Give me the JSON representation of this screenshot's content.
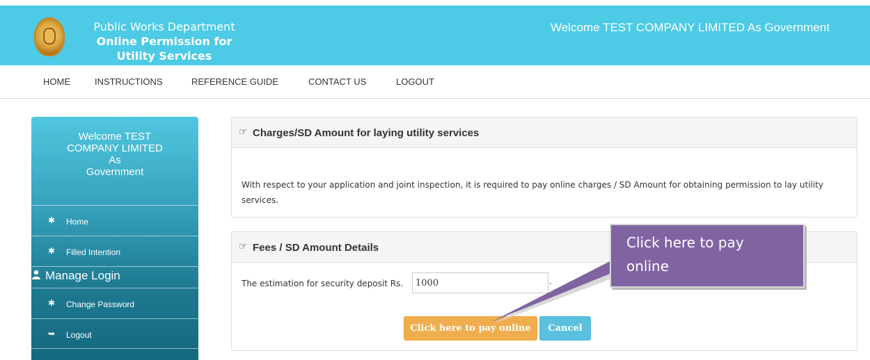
{
  "header": {
    "dept_line1": "Public Works Department",
    "dept_line2": "Online Permission for",
    "dept_line3": "Utility Services",
    "welcome": "Welcome TEST COMPANY LIMITED As Government",
    "bg_color": "#4ccae6",
    "emblem_icon": "government-emblem-icon"
  },
  "nav": {
    "items": [
      "HOME",
      "INSTRUCTIONS",
      "REFERENCE GUIDE",
      "CONTACT US",
      "LOGOUT"
    ]
  },
  "sidebar": {
    "welcome_line1": "Welcome TEST",
    "welcome_line2": "COMPANY LIMITED",
    "welcome_line3": "As",
    "welcome_line4": "Government",
    "items": [
      {
        "label": "Home",
        "icon": "gear-icon"
      },
      {
        "label": "Filled Intention",
        "icon": "gear-icon"
      }
    ],
    "section_label": "Manage Login",
    "section_icon": "user-icon",
    "login_items": [
      {
        "label": "Change Password",
        "icon": "gear-icon"
      },
      {
        "label": "Logout",
        "icon": "logout-icon"
      }
    ]
  },
  "charges_panel": {
    "title": "Charges/SD Amount for laying utility services",
    "icon": "pointing-hand-icon",
    "body_line1": "With respect to your application and joint inspection, it is required to pay online charges / SD Amount for obtaining permission to lay utility",
    "body_line2": "services."
  },
  "fees_panel": {
    "title": "Fees / SD Amount Details",
    "icon": "pointing-hand-icon",
    "estimation_label": "The estimation for security deposit Rs.",
    "estimation_value": "1000",
    "trailing_dot": ".",
    "pay_button": "Click here to pay online",
    "cancel_button": "Cancel",
    "pay_color": "#f0ad4e",
    "cancel_color": "#5bc0de"
  },
  "callout": {
    "line1": "Click here to pay",
    "line2": "online",
    "color": "#8064a2"
  }
}
